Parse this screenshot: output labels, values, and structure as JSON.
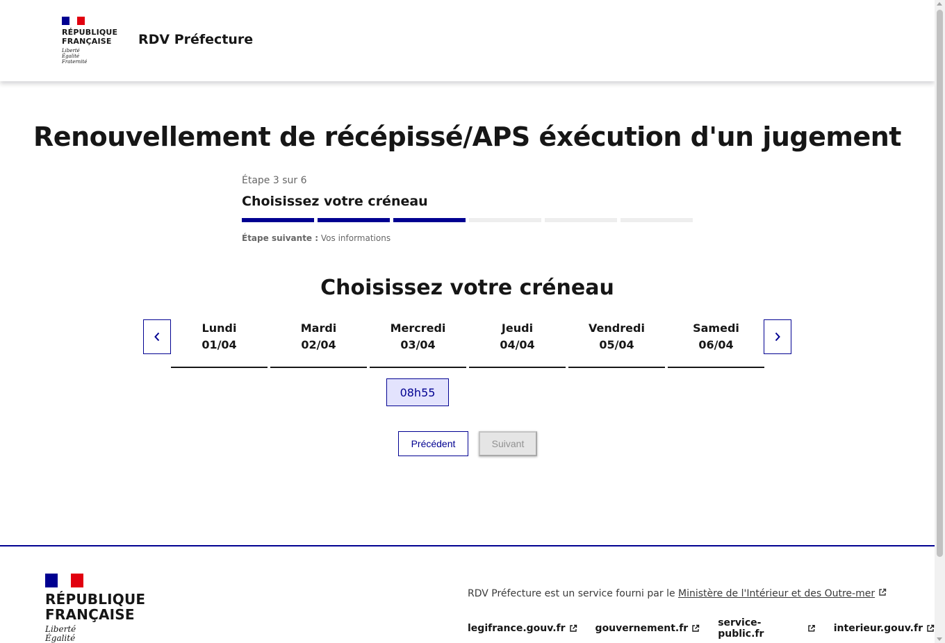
{
  "header": {
    "logo_line1": "RÉPUBLIQUE",
    "logo_line2": "FRANÇAISE",
    "motto_line1": "Liberté",
    "motto_line2": "Égalité",
    "motto_line3": "Fraternité",
    "service_title": "RDV Préfecture"
  },
  "main": {
    "title": "Renouvellement de récépissé/APS éxécution d'un jugement"
  },
  "stepper": {
    "state": "Étape 3 sur 6",
    "title": "Choisissez votre créneau",
    "current_step": 3,
    "total_steps": 6,
    "next_label": "Étape suivante :",
    "next_value": "Vos informations"
  },
  "slots": {
    "title": "Choisissez votre créneau",
    "days": [
      {
        "name": "Lundi",
        "date": "01/04"
      },
      {
        "name": "Mardi",
        "date": "02/04"
      },
      {
        "name": "Mercredi",
        "date": "03/04"
      },
      {
        "name": "Jeudi",
        "date": "04/04"
      },
      {
        "name": "Vendredi",
        "date": "05/04"
      },
      {
        "name": "Samedi",
        "date": "06/04"
      }
    ],
    "available_slot": "08h55",
    "prev_icon": "chevron-left-icon",
    "next_icon": "chevron-right-icon"
  },
  "actions": {
    "previous": "Précédent",
    "next": "Suivant"
  },
  "footer": {
    "logo_line1": "RÉPUBLIQUE",
    "logo_line2": "FRANÇAISE",
    "motto_line1": "Liberté",
    "motto_line2": "Égalité",
    "desc_prefix": "RDV Préfecture est un service fourni par le ",
    "desc_link": "Ministère de l'Intérieur et des Outre-mer",
    "links": [
      "legifrance.gouv.fr",
      "gouvernement.fr",
      "service-public.fr",
      "interieur.gouv.fr"
    ]
  },
  "colors": {
    "primary": "#000091",
    "slot_bg": "#e3e3fd",
    "flag_red": "#e1000f",
    "disabled_bg": "#e5e5e5"
  }
}
